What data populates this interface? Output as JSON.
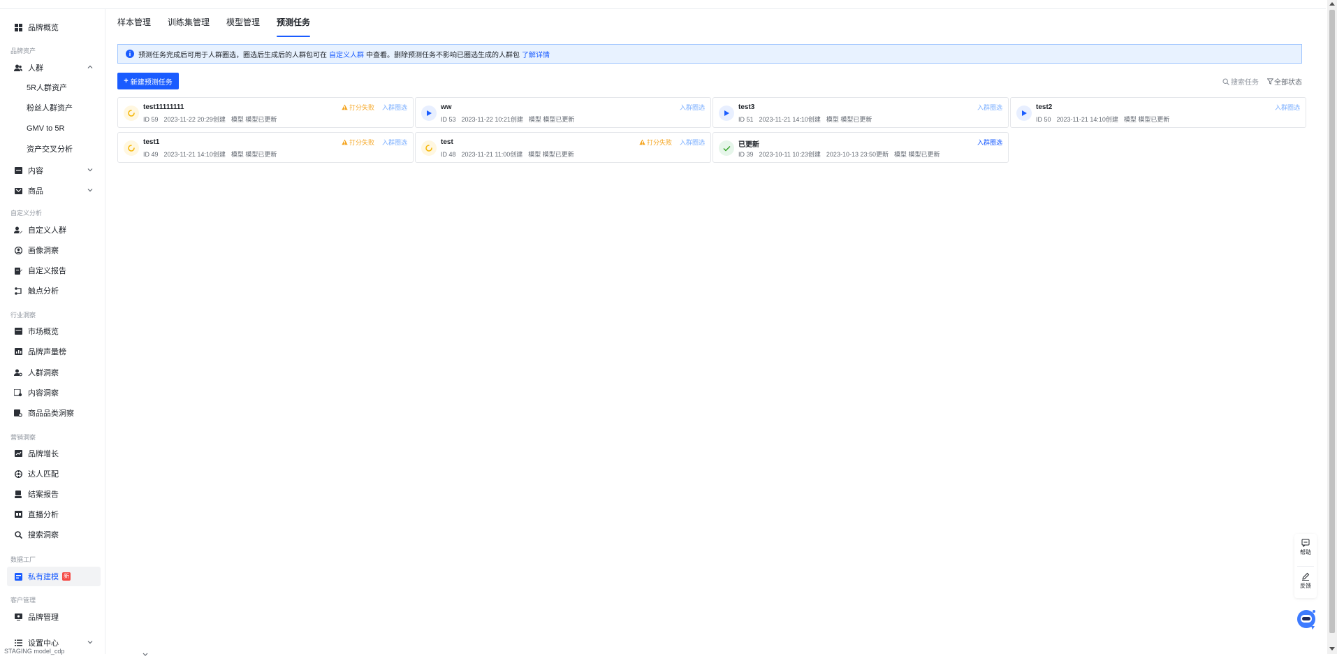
{
  "sidebar": {
    "top_item": {
      "label": "品牌概览",
      "icon": "grid-icon"
    },
    "groups": [
      {
        "label": "品牌资产"
      },
      {
        "label": "自定义分析"
      },
      {
        "label": "行业洞察"
      },
      {
        "label": "营销洞察"
      },
      {
        "label": "数据工厂"
      },
      {
        "label": "客户管理"
      }
    ],
    "crowd": {
      "label": "人群",
      "icon": "users-icon",
      "expanded": true,
      "children": [
        "5R人群资产",
        "粉丝人群资产",
        "GMV to 5R",
        "资产交叉分析"
      ]
    },
    "content": {
      "label": "内容",
      "icon": "content-icon"
    },
    "goods": {
      "label": "商品",
      "icon": "goods-icon"
    },
    "custom_items": [
      {
        "label": "自定义人群",
        "icon": "user-edit-icon"
      },
      {
        "label": "画像洞察",
        "icon": "portrait-icon"
      },
      {
        "label": "自定义报告",
        "icon": "report-edit-icon"
      },
      {
        "label": "触点分析",
        "icon": "touchpoint-icon"
      }
    ],
    "industry_items": [
      {
        "label": "市场概览",
        "icon": "market-icon"
      },
      {
        "label": "品牌声量榜",
        "icon": "volume-chart-icon"
      },
      {
        "label": "人群洞察",
        "icon": "crowd-insight-icon"
      },
      {
        "label": "内容洞察",
        "icon": "content-insight-icon"
      },
      {
        "label": "商品品类洞察",
        "icon": "category-insight-icon"
      }
    ],
    "marketing_items": [
      {
        "label": "品牌增长",
        "icon": "growth-icon"
      },
      {
        "label": "达人匹配",
        "icon": "match-icon"
      },
      {
        "label": "结案报告",
        "icon": "closing-report-icon"
      },
      {
        "label": "直播分析",
        "icon": "live-icon"
      },
      {
        "label": "搜索洞察",
        "icon": "search-icon"
      }
    ],
    "factory_item": {
      "label": "私有建模",
      "badge": "新",
      "icon": "model-icon",
      "active": true
    },
    "customer_item": {
      "label": "品牌管理",
      "icon": "brand-manage-icon"
    },
    "settings_item": {
      "label": "设置中心",
      "icon": "settings-list-icon"
    },
    "footer": "STAGING model_cdp"
  },
  "tabs": [
    {
      "label": "样本管理",
      "active": false
    },
    {
      "label": "训练集管理",
      "active": false
    },
    {
      "label": "模型管理",
      "active": false
    },
    {
      "label": "预测任务",
      "active": true
    }
  ],
  "notice": {
    "text_before": "预测任务完成后可用于人群圈选，圈选后生成后的人群包可在",
    "link1": "自定义人群",
    "text_after": "中查看。删除预测任务不影响已圈选生成的人群包",
    "link2": "了解详情"
  },
  "toolbar": {
    "new_button": "新建预测任务",
    "search_placeholder": "搜索任务",
    "filter_label": "全部状态"
  },
  "tasks": [
    {
      "name": "test11111111",
      "status": "loading",
      "id": "ID 59",
      "created": "2023-11-22 20:29创建",
      "model": "模型 模型已更新",
      "warning": "打分失败",
      "action": "入群圈选"
    },
    {
      "name": "ww",
      "status": "play",
      "id": "ID 53",
      "created": "2023-11-22 10:21创建",
      "model": "模型 模型已更新",
      "warning": "",
      "action": "入群圈选"
    },
    {
      "name": "test3",
      "status": "play",
      "id": "ID 51",
      "created": "2023-11-21 14:10创建",
      "model": "模型 模型已更新",
      "warning": "",
      "action": "入群圈选"
    },
    {
      "name": "test2",
      "status": "play",
      "id": "ID 50",
      "created": "2023-11-21 14:10创建",
      "model": "模型 模型已更新",
      "warning": "",
      "action": "入群圈选"
    },
    {
      "name": "test1",
      "status": "loading",
      "id": "ID 49",
      "created": "2023-11-21 14:10创建",
      "model": "模型 模型已更新",
      "warning": "打分失败",
      "action": "入群圈选"
    },
    {
      "name": "test",
      "status": "loading",
      "id": "ID 48",
      "created": "2023-11-21 11:00创建",
      "model": "模型 模型已更新",
      "warning": "打分失败",
      "action": "入群圈选"
    },
    {
      "name": "已更新",
      "status": "done",
      "id": "ID 39",
      "created": "2023-10-11 10:23创建",
      "updated": "2023-10-13 23:50更新",
      "model": "模型 模型已更新",
      "warning": "",
      "action": "入群圈选"
    }
  ],
  "float_panel": {
    "help": "帮助",
    "feedback": "反馈"
  },
  "colors": {
    "primary": "#1a5cff",
    "warning": "#f5a623",
    "success": "#2ea121",
    "notice_bg": "#e8f2ff"
  }
}
